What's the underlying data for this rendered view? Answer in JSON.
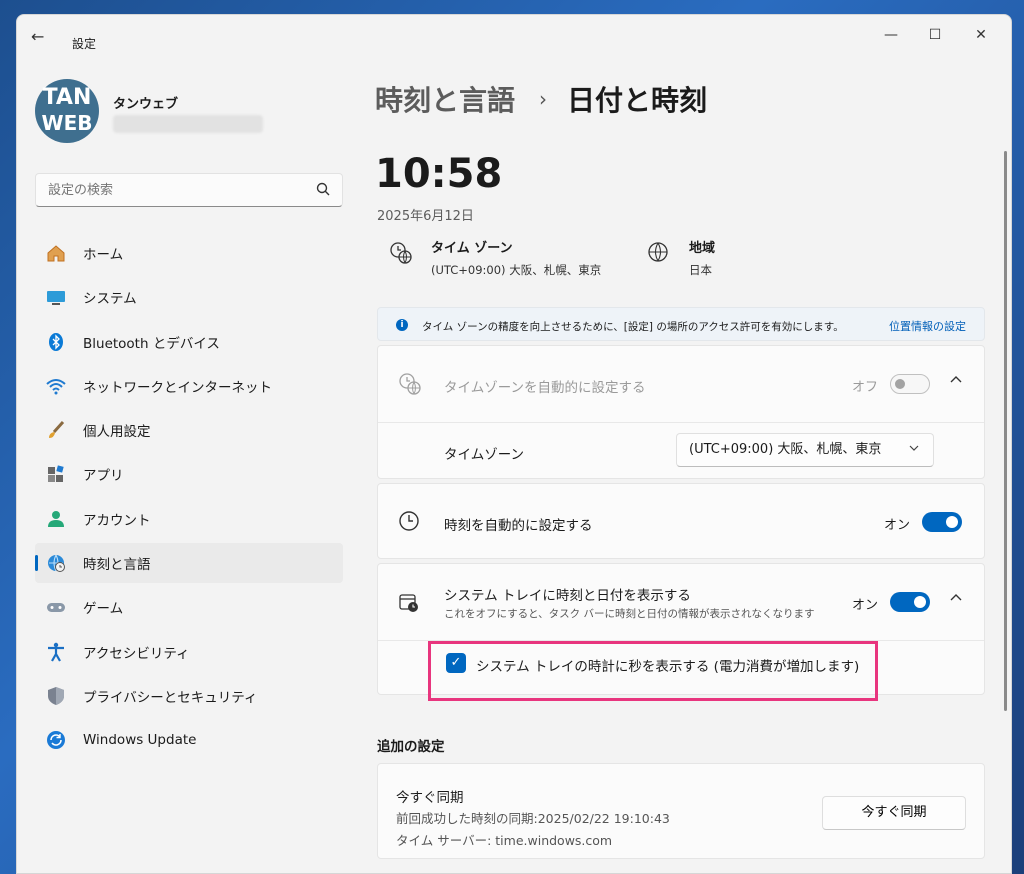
{
  "window": {
    "title": "設定",
    "controls": {
      "minimize": "—",
      "maximize": "☐",
      "close": "✕"
    }
  },
  "user": {
    "avatar_line1": "TAN",
    "avatar_line2": "WEB",
    "name": "タンウェブ"
  },
  "search": {
    "placeholder": "設定の検索"
  },
  "sidebar": {
    "items": [
      {
        "label": "ホーム",
        "icon": "home-icon"
      },
      {
        "label": "システム",
        "icon": "monitor-icon"
      },
      {
        "label": "Bluetooth とデバイス",
        "icon": "bluetooth-icon"
      },
      {
        "label": "ネットワークとインターネット",
        "icon": "wifi-icon"
      },
      {
        "label": "個人用設定",
        "icon": "brush-icon"
      },
      {
        "label": "アプリ",
        "icon": "apps-icon"
      },
      {
        "label": "アカウント",
        "icon": "person-icon"
      },
      {
        "label": "時刻と言語",
        "icon": "globe-clock-icon",
        "active": true
      },
      {
        "label": "ゲーム",
        "icon": "gamepad-icon"
      },
      {
        "label": "アクセシビリティ",
        "icon": "accessibility-icon"
      },
      {
        "label": "プライバシーとセキュリティ",
        "icon": "shield-icon"
      },
      {
        "label": "Windows Update",
        "icon": "sync-icon"
      }
    ]
  },
  "breadcrumb": {
    "parent": "時刻と言語",
    "separator": "›",
    "current": "日付と時刻"
  },
  "clock": {
    "time": "10:58",
    "date": "2025年6月12日"
  },
  "timezone_info": {
    "title": "タイム ゾーン",
    "value": "(UTC+09:00) 大阪、札幌、東京"
  },
  "region_info": {
    "title": "地域",
    "value": "日本"
  },
  "notice": {
    "text": "タイム ゾーンの精度を向上させるために、[設定] の場所のアクセス許可を有効にします。",
    "link": "位置情報の設定"
  },
  "auto_timezone": {
    "label": "タイムゾーンを自動的に設定する",
    "state": "オフ"
  },
  "timezone_select": {
    "label": "タイムゾーン",
    "value": "(UTC+09:00) 大阪、札幌、東京"
  },
  "auto_time": {
    "label": "時刻を自動的に設定する",
    "state": "オン"
  },
  "tray": {
    "label": "システム トレイに時刻と日付を表示する",
    "sub": "これをオフにすると、タスク バーに時刻と日付の情報が表示されなくなります",
    "state": "オン",
    "seconds_checkbox": "システム トレイの時計に秒を表示する (電力消費が増加します)"
  },
  "additional": {
    "title": "追加の設定",
    "sync_title": "今すぐ同期",
    "last_sync": "前回成功した時刻の同期:2025/02/22 19:10:43",
    "server": "タイム サーバー: time.windows.com",
    "sync_button": "今すぐ同期"
  },
  "colors": {
    "accent": "#0067c0",
    "highlight": "#e8357e"
  }
}
